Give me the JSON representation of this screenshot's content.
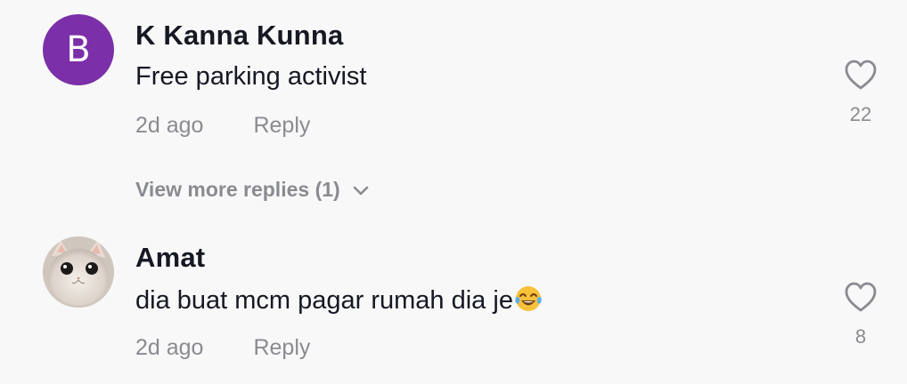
{
  "comments": [
    {
      "avatar_letter": "B",
      "avatar_color": "#7b2fa8",
      "username": "K Kanna Kunna",
      "text": "Free parking activist",
      "time": "2d ago",
      "reply_label": "Reply",
      "likes": "22",
      "view_replies_label": "View more replies (1)"
    },
    {
      "avatar_icon": "cat-photo-avatar",
      "username": "Amat",
      "text": "dia buat mcm pagar rumah dia je",
      "emoji_icon": "tears-of-joy-emoji",
      "time": "2d ago",
      "reply_label": "Reply",
      "likes": "8"
    }
  ],
  "colors": {
    "background": "#f8f8f8",
    "text_primary": "#161823",
    "text_secondary": "#8a8b91"
  }
}
